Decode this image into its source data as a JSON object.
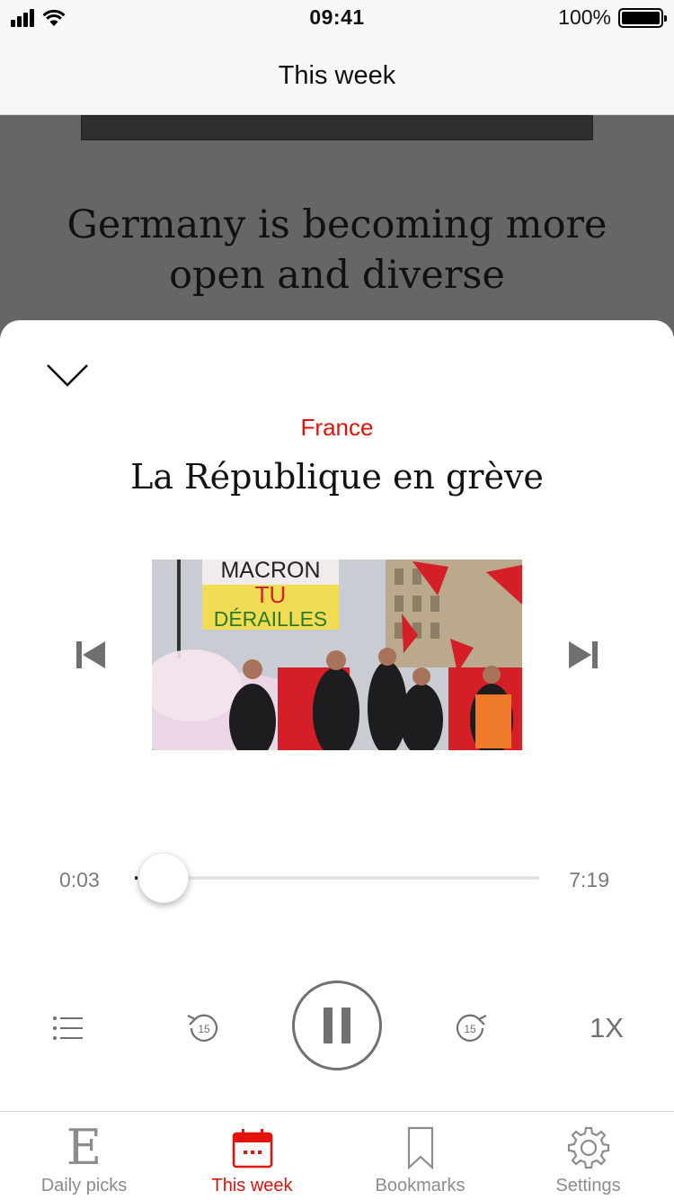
{
  "status_bar": {
    "time": "09:41",
    "battery": "100%"
  },
  "nav": {
    "title": "This week"
  },
  "article_behind": {
    "headline": "Germany is becoming more open and diverse"
  },
  "player": {
    "section": "France",
    "title": "La République en grève",
    "artwork_sign_lines": [
      "MACRON",
      "TU",
      "DÉRAILLES"
    ],
    "elapsed": "0:03",
    "duration": "7:19",
    "progress_fraction": 0.007,
    "rewind_seconds": "15",
    "forward_seconds": "15",
    "speed": "1X"
  },
  "tabs": [
    {
      "label": "Daily picks",
      "icon": "economist-e-icon",
      "active": false
    },
    {
      "label": "This week",
      "icon": "calendar-icon",
      "active": true
    },
    {
      "label": "Bookmarks",
      "icon": "bookmark-icon",
      "active": false
    },
    {
      "label": "Settings",
      "icon": "gear-icon",
      "active": false
    }
  ],
  "colors": {
    "accent": "#e3120b",
    "control_gray": "#707070",
    "overlay": "#666666"
  }
}
